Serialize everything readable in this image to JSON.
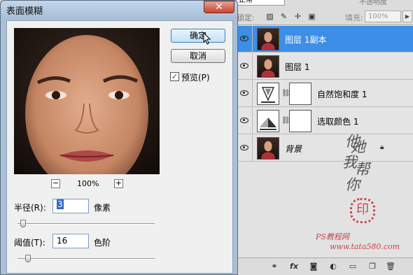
{
  "dialog": {
    "title": "表面模糊",
    "close_label": "✕",
    "ok_label": "确定",
    "cancel_label": "取消",
    "preview_checkbox": {
      "label": "预览(P)",
      "checked": true,
      "mark": "✓"
    },
    "zoom": {
      "minus": "−",
      "level": "100%",
      "plus": "+"
    },
    "radius": {
      "label": "半径(R):",
      "value": "3",
      "unit": "像素",
      "slider_fraction": 0.02
    },
    "threshold": {
      "label": "阈值(T):",
      "value": "16",
      "unit": "色阶",
      "slider_fraction": 0.06
    }
  },
  "layers_panel": {
    "blend_mode": "正常",
    "opacity_label": "不透明度",
    "lock_label": "锁定:",
    "fill_label": "填充:",
    "fill_value": "100%",
    "layers": [
      {
        "name": "图层 1副本",
        "type": "image",
        "selected": true
      },
      {
        "name": "图层 1",
        "type": "image",
        "selected": false
      },
      {
        "name": "自然饱和度 1",
        "type": "adjustment",
        "selected": false
      },
      {
        "name": "选取颜色 1",
        "type": "adjustment",
        "selected": false
      },
      {
        "name": "背景",
        "type": "background",
        "selected": false,
        "locked": true
      }
    ],
    "footer_icons": [
      "link-icon",
      "fx-icon",
      "mask-icon",
      "adjustment-icon",
      "group-icon",
      "new-layer-icon",
      "trash-icon"
    ]
  },
  "watermark": {
    "chars": [
      "他",
      "她",
      "我",
      "帮",
      "你"
    ],
    "seal": "印",
    "site_line1": "PS教程网",
    "site_line2": "www.tata580.com"
  },
  "colors": {
    "selected_row": "#3d8ee6",
    "dialog_frame": "#a9bfd6",
    "close_button": "#c9452f"
  }
}
